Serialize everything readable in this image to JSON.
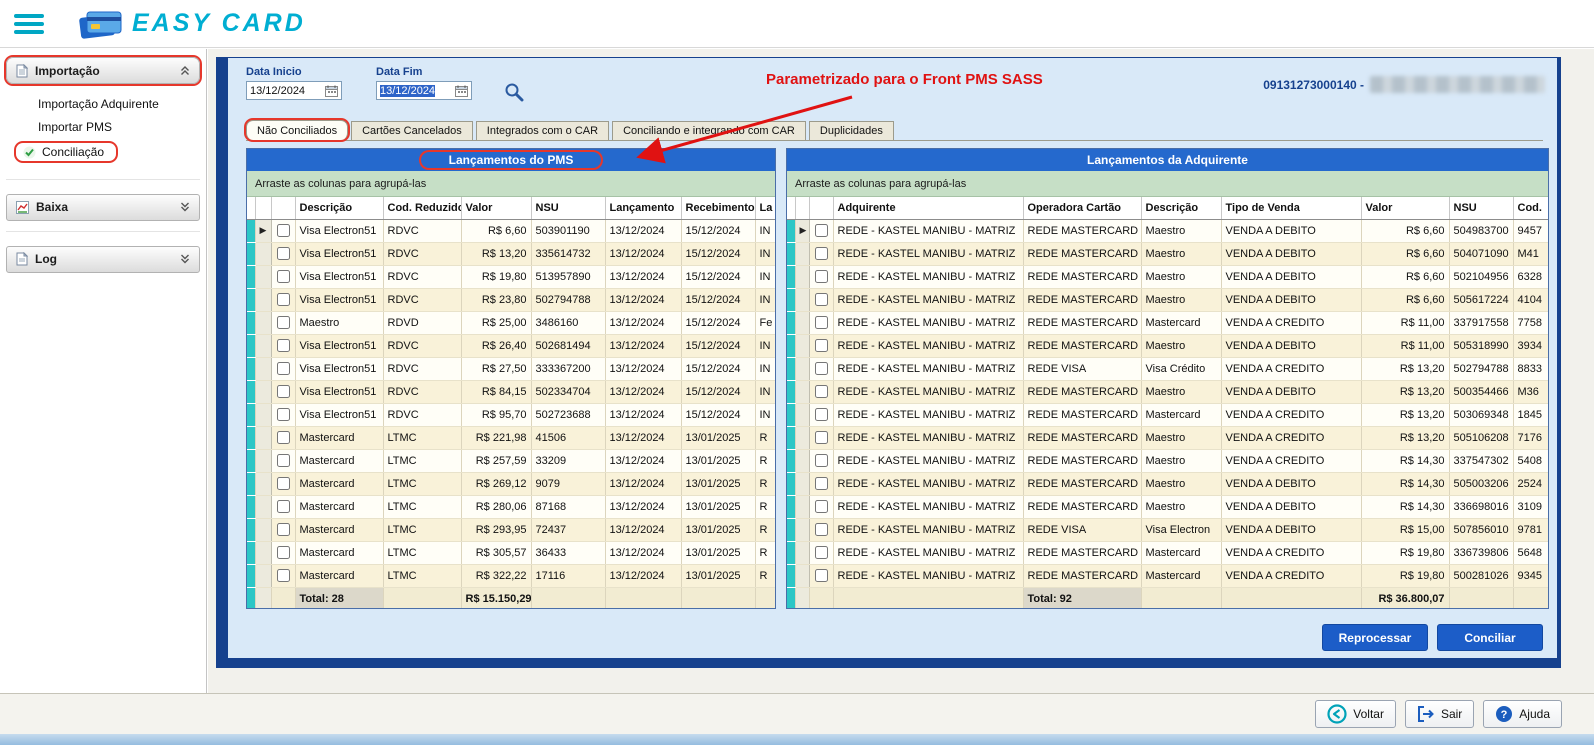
{
  "app": {
    "logo_text": "EASY CARD"
  },
  "sidebar": {
    "sections": [
      {
        "label": "Importação",
        "items": [
          {
            "label": "Importação Adquirente"
          },
          {
            "label": "Importar PMS"
          },
          {
            "label": "Conciliação"
          }
        ]
      },
      {
        "label": "Baixa"
      },
      {
        "label": "Log"
      }
    ]
  },
  "filters": {
    "start_label": "Data Inicio",
    "start_value": "13/12/2024",
    "end_label": "Data Fim",
    "end_value": "13/12/2024",
    "company_code": "09131273000140 -"
  },
  "annotation": {
    "note": "Parametrizado para o Front PMS SASS"
  },
  "tabs": [
    {
      "label": "Não Conciliados"
    },
    {
      "label": "Cartões Cancelados"
    },
    {
      "label": "Integrados com o CAR"
    },
    {
      "label": "Conciliando e integrando com CAR"
    },
    {
      "label": "Duplicidades"
    }
  ],
  "pms_panel": {
    "title": "Lançamentos do PMS",
    "drag_hint": "Arraste as colunas para agrupá-las",
    "columns": [
      "Descrição",
      "Cod. Reduzido",
      "Valor",
      "NSU",
      "Lançamento",
      "Recebimento",
      "La"
    ],
    "rows": [
      [
        "Visa Electron51",
        "RDVC",
        "R$ 6,60",
        "503901190",
        "13/12/2024",
        "15/12/2024",
        "IN"
      ],
      [
        "Visa Electron51",
        "RDVC",
        "R$ 13,20",
        "335614732",
        "13/12/2024",
        "15/12/2024",
        "IN"
      ],
      [
        "Visa Electron51",
        "RDVC",
        "R$ 19,80",
        "513957890",
        "13/12/2024",
        "15/12/2024",
        "IN"
      ],
      [
        "Visa Electron51",
        "RDVC",
        "R$ 23,80",
        "502794788",
        "13/12/2024",
        "15/12/2024",
        "IN"
      ],
      [
        "Maestro",
        "RDVD",
        "R$ 25,00",
        "3486160",
        "13/12/2024",
        "15/12/2024",
        "Fe"
      ],
      [
        "Visa Electron51",
        "RDVC",
        "R$ 26,40",
        "502681494",
        "13/12/2024",
        "15/12/2024",
        "IN"
      ],
      [
        "Visa Electron51",
        "RDVC",
        "R$ 27,50",
        "333367200",
        "13/12/2024",
        "15/12/2024",
        "IN"
      ],
      [
        "Visa Electron51",
        "RDVC",
        "R$ 84,15",
        "502334704",
        "13/12/2024",
        "15/12/2024",
        "IN"
      ],
      [
        "Visa Electron51",
        "RDVC",
        "R$ 95,70",
        "502723688",
        "13/12/2024",
        "15/12/2024",
        "IN"
      ],
      [
        "Mastercard",
        "LTMC",
        "R$ 221,98",
        "41506",
        "13/12/2024",
        "13/01/2025",
        "R"
      ],
      [
        "Mastercard",
        "LTMC",
        "R$ 257,59",
        "33209",
        "13/12/2024",
        "13/01/2025",
        "R"
      ],
      [
        "Mastercard",
        "LTMC",
        "R$ 269,12",
        "9079",
        "13/12/2024",
        "13/01/2025",
        "R"
      ],
      [
        "Mastercard",
        "LTMC",
        "R$ 280,06",
        "87168",
        "13/12/2024",
        "13/01/2025",
        "R"
      ],
      [
        "Mastercard",
        "LTMC",
        "R$ 293,95",
        "72437",
        "13/12/2024",
        "13/01/2025",
        "R"
      ],
      [
        "Mastercard",
        "LTMC",
        "R$ 305,57",
        "36433",
        "13/12/2024",
        "13/01/2025",
        "R"
      ],
      [
        "Mastercard",
        "LTMC",
        "R$ 322,22",
        "17116",
        "13/12/2024",
        "13/01/2025",
        "R"
      ]
    ],
    "total_label": "Total: 28",
    "total_value": "R$ 15.150,29"
  },
  "adq_panel": {
    "title": "Lançamentos da Adquirente",
    "drag_hint": "Arraste as colunas para agrupá-las",
    "columns": [
      "Adquirente",
      "Operadora Cartão",
      "Descrição",
      "Tipo de Venda",
      "Valor",
      "NSU",
      "Cod."
    ],
    "rows": [
      [
        "REDE - KASTEL MANIBU - MATRIZ",
        "REDE MASTERCARD",
        "Maestro",
        "VENDA A DEBITO",
        "R$ 6,60",
        "504983700",
        "9457"
      ],
      [
        "REDE - KASTEL MANIBU - MATRIZ",
        "REDE MASTERCARD",
        "Maestro",
        "VENDA A DEBITO",
        "R$ 6,60",
        "504071090",
        "M41"
      ],
      [
        "REDE - KASTEL MANIBU - MATRIZ",
        "REDE MASTERCARD",
        "Maestro",
        "VENDA A DEBITO",
        "R$ 6,60",
        "502104956",
        "6328"
      ],
      [
        "REDE - KASTEL MANIBU - MATRIZ",
        "REDE MASTERCARD",
        "Maestro",
        "VENDA A DEBITO",
        "R$ 6,60",
        "505617224",
        "4104"
      ],
      [
        "REDE - KASTEL MANIBU - MATRIZ",
        "REDE MASTERCARD",
        "Mastercard",
        "VENDA A CREDITO",
        "R$ 11,00",
        "337917558",
        "7758"
      ],
      [
        "REDE - KASTEL MANIBU - MATRIZ",
        "REDE MASTERCARD",
        "Maestro",
        "VENDA A DEBITO",
        "R$ 11,00",
        "505318990",
        "3934"
      ],
      [
        "REDE - KASTEL MANIBU - MATRIZ",
        "REDE VISA",
        "Visa Crédito",
        "VENDA A CREDITO",
        "R$ 13,20",
        "502794788",
        "8833"
      ],
      [
        "REDE - KASTEL MANIBU - MATRIZ",
        "REDE MASTERCARD",
        "Maestro",
        "VENDA A DEBITO",
        "R$ 13,20",
        "500354466",
        "M36"
      ],
      [
        "REDE - KASTEL MANIBU - MATRIZ",
        "REDE MASTERCARD",
        "Mastercard",
        "VENDA A CREDITO",
        "R$ 13,20",
        "503069348",
        "1845"
      ],
      [
        "REDE - KASTEL MANIBU - MATRIZ",
        "REDE MASTERCARD",
        "Maestro",
        "VENDA A CREDITO",
        "R$ 13,20",
        "505106208",
        "7176"
      ],
      [
        "REDE - KASTEL MANIBU - MATRIZ",
        "REDE MASTERCARD",
        "Maestro",
        "VENDA A CREDITO",
        "R$ 14,30",
        "337547302",
        "5408"
      ],
      [
        "REDE - KASTEL MANIBU - MATRIZ",
        "REDE MASTERCARD",
        "Maestro",
        "VENDA A DEBITO",
        "R$ 14,30",
        "505003206",
        "2524"
      ],
      [
        "REDE - KASTEL MANIBU - MATRIZ",
        "REDE MASTERCARD",
        "Maestro",
        "VENDA A DEBITO",
        "R$ 14,30",
        "336698016",
        "3109"
      ],
      [
        "REDE - KASTEL MANIBU - MATRIZ",
        "REDE VISA",
        "Visa Electron",
        "VENDA A DEBITO",
        "R$ 15,00",
        "507856010",
        "9781"
      ],
      [
        "REDE - KASTEL MANIBU - MATRIZ",
        "REDE MASTERCARD",
        "Mastercard",
        "VENDA A CREDITO",
        "R$ 19,80",
        "336739806",
        "5648"
      ],
      [
        "REDE - KASTEL MANIBU - MATRIZ",
        "REDE MASTERCARD",
        "Mastercard",
        "VENDA A CREDITO",
        "R$ 19,80",
        "500281026",
        "9345"
      ]
    ],
    "total_label": "Total: 92",
    "total_value": "R$ 36.800,07"
  },
  "actions": {
    "reprocess_label": "Reprocessar",
    "reconcile_label": "Conciliar"
  },
  "footer": {
    "back_label": "Voltar",
    "exit_label": "Sair",
    "help_label": "Ajuda"
  }
}
